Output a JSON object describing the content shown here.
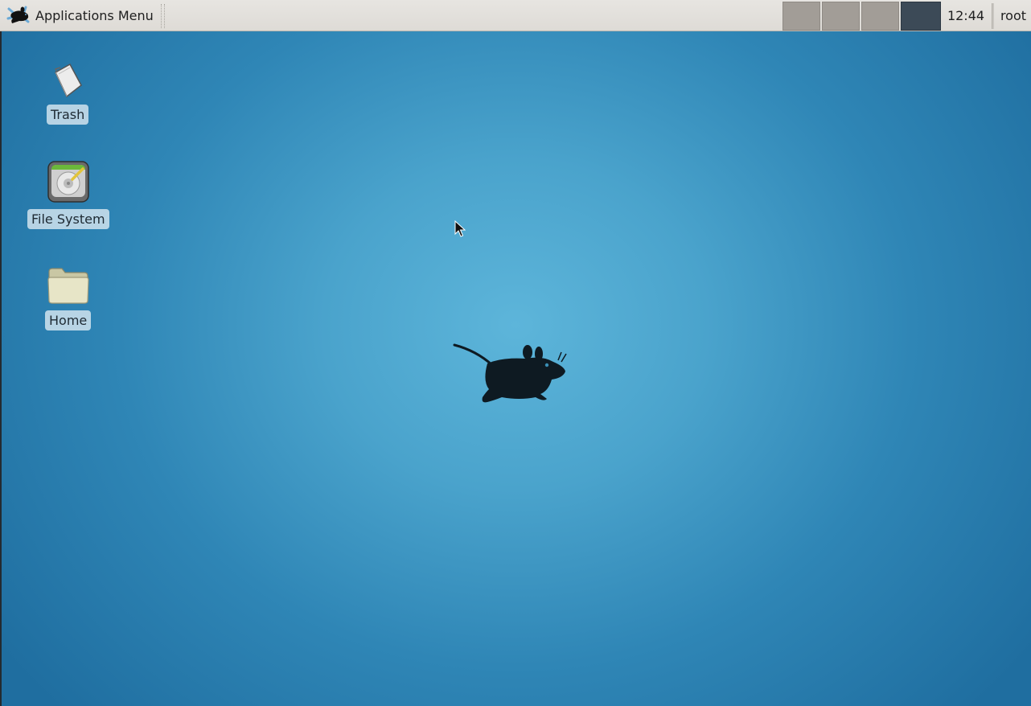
{
  "panel": {
    "app_menu_label": "Applications Menu",
    "clock": "12:44",
    "user": "root",
    "workspaces": [
      {
        "active": false
      },
      {
        "active": false
      },
      {
        "active": false
      },
      {
        "active": true
      }
    ]
  },
  "desktop": {
    "icons": [
      {
        "label": "Trash",
        "icon": "trash-icon"
      },
      {
        "label": "File System",
        "icon": "drive-icon"
      },
      {
        "label": "Home",
        "icon": "folder-icon"
      }
    ]
  },
  "colors": {
    "panel_bg": "#e0ddd8",
    "workspace_inactive": "#a29d97",
    "workspace_active": "#3c4a57",
    "wallpaper_center": "#5db5da",
    "wallpaper_edge": "#1f6ea0"
  }
}
